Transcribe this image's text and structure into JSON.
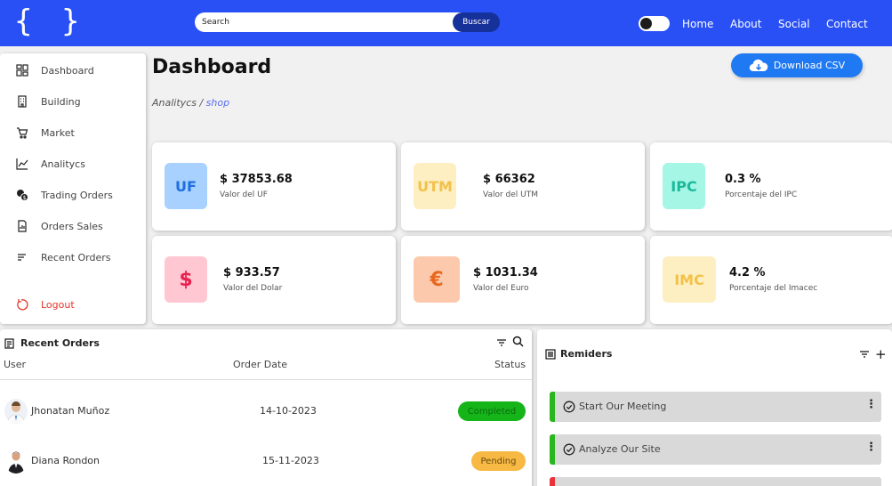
{
  "header": {
    "logo_text": "{ }",
    "search": {
      "placeholder": "Search",
      "button_label": "Buscar"
    },
    "nav": [
      "Home",
      "About",
      "Social",
      "Contact"
    ]
  },
  "sidebar": {
    "items": [
      {
        "label": "Dashboard",
        "icon": "dashboard-icon"
      },
      {
        "label": "Building",
        "icon": "building-icon"
      },
      {
        "label": "Market",
        "icon": "cart-icon"
      },
      {
        "label": "Analitycs",
        "icon": "chart-line-icon"
      },
      {
        "label": "Trading Orders",
        "icon": "coins-icon"
      },
      {
        "label": "Orders Sales",
        "icon": "receipt-icon"
      },
      {
        "label": "Recent Orders",
        "icon": "list-icon"
      }
    ],
    "logout": {
      "label": "Logout",
      "icon": "logout-icon"
    }
  },
  "page": {
    "title": "Dashboard",
    "breadcrumb": {
      "root": "Analitycs",
      "separator": " / ",
      "current": "shop"
    },
    "download_label": "Download CSV"
  },
  "cards": [
    {
      "badge": "UF",
      "value": "$ 37853.68",
      "label": "Valor del UF",
      "badge_bg": "#a8d1ff",
      "badge_color": "#1e6fe0"
    },
    {
      "badge": "UTM",
      "value": "$ 66362",
      "label": "Valor del UTM",
      "badge_bg": "#fdefc2",
      "badge_color": "#f2c14a"
    },
    {
      "badge": "IPC",
      "value": "0.3 %",
      "label": "Porcentaje del IPC",
      "badge_bg": "#a6f6e6",
      "badge_color": "#1bb99a"
    },
    {
      "badge": "$",
      "value": "$ 933.57",
      "label": "Valor del Dolar",
      "badge_bg": "#ffc7d2",
      "badge_color": "#e8214f"
    },
    {
      "badge": "€",
      "value": "$ 1031.34",
      "label": "Valor del Euro",
      "badge_bg": "#fcc9ad",
      "badge_color": "#e8691e"
    },
    {
      "badge": "IMC",
      "value": "4.2 %",
      "label": "Porcentaje del Imacec",
      "badge_bg": "#fdefc2",
      "badge_color": "#f2c14a"
    }
  ],
  "orders": {
    "title": "Recent Orders",
    "columns": [
      "User",
      "Order Date",
      "Status"
    ],
    "rows": [
      {
        "user": "Jhonatan Muñoz",
        "date": "14-10-2023",
        "status": "Completed",
        "status_bg": "#15b51a",
        "status_color": "#0b6a0e"
      },
      {
        "user": "Diana Rondon",
        "date": "15-11-2023",
        "status": "Pending",
        "status_bg": "#f7b944",
        "status_color": "#6b4a10"
      }
    ]
  },
  "reminders": {
    "title": "Remiders",
    "items": [
      {
        "text": "Start Our Meeting",
        "accent": "#2bb51e"
      },
      {
        "text": "Analyze Our Site",
        "accent": "#2bb51e"
      },
      {
        "text": "",
        "accent": "#e8333a"
      }
    ]
  },
  "colors": {
    "brand": "#2850f5",
    "primary_button": "#1e79f2",
    "search_button": "#17319a"
  }
}
